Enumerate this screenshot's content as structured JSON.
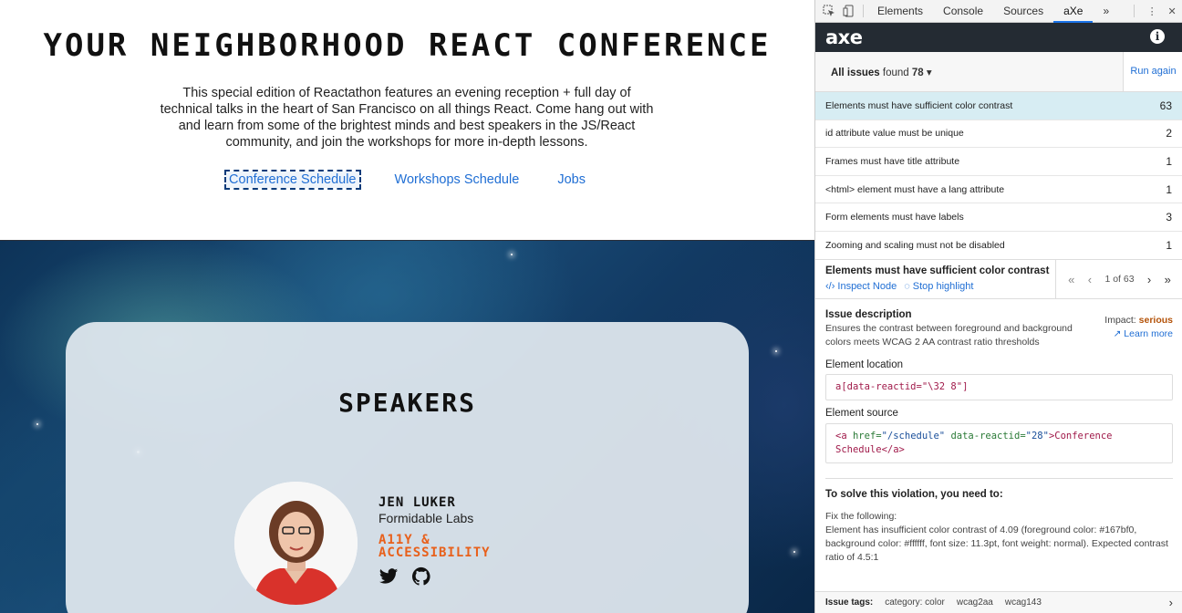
{
  "site": {
    "title": "YOUR NEIGHBORHOOD REACT CONFERENCE",
    "description": "This special edition of Reactathon features an evening reception + full day of technical talks in the heart of San Francisco on all things React. Come hang out with and learn from some of the brightest minds and best speakers in the JS/React community, and join the workshops for more in-depth lessons.",
    "nav": [
      "Conference Schedule",
      "Workshops Schedule",
      "Jobs"
    ],
    "speakers_heading": "SPEAKERS",
    "speaker": {
      "name": "JEN LUKER",
      "company": "Formidable Labs",
      "topic": "A11Y & ACCESSIBILITY"
    },
    "social_icons": [
      "twitter-icon",
      "github-icon"
    ]
  },
  "devtools": {
    "tabs": [
      "Elements",
      "Console",
      "Sources",
      "aXe"
    ],
    "active_tab": "aXe",
    "more": "»",
    "axe_logo": "axe",
    "issues_label": "All issues",
    "issues_found_label": "found",
    "issues_total": "78",
    "run_again": "Run again",
    "issues": [
      {
        "label": "Elements must have sufficient color contrast",
        "count": "63"
      },
      {
        "label": "id attribute value must be unique",
        "count": "2"
      },
      {
        "label": "Frames must have title attribute",
        "count": "1"
      },
      {
        "label": "<html> element must have a lang attribute",
        "count": "1"
      },
      {
        "label": "Form elements must have labels",
        "count": "3"
      },
      {
        "label": "Zooming and scaling must not be disabled",
        "count": "1"
      }
    ],
    "detail": {
      "title": "Elements must have sufficient color contrast",
      "inspect_node": "Inspect Node",
      "stop_highlight": "Stop highlight",
      "pager": "1 of 63",
      "issue_description_h": "Issue description",
      "issue_description": "Ensures the contrast between foreground and background colors meets WCAG 2 AA contrast ratio thresholds",
      "impact_label": "Impact:",
      "impact_value": "serious",
      "learn_more": "Learn more",
      "element_location_h": "Element location",
      "element_location": "a[data-reactid=\"\\32 8\"]",
      "element_source_h": "Element source",
      "source_tag_open": "<a",
      "source_attr1": "href=",
      "source_val1": "\"/schedule\"",
      "source_attr2": "data-reactid=",
      "source_val2": "\"28\"",
      "source_text": ">Conference",
      "source_text2": "Schedule</",
      "source_tag_close": "a",
      "source_end": ">",
      "solve_h": "To solve this violation, you need to:",
      "fix_following": "Fix the following:",
      "fix_detail": "Element has insufficient color contrast of 4.09 (foreground color: #167bf0, background color: #ffffff, font size: 11.3pt, font weight: normal). Expected contrast ratio of 4.5:1"
    },
    "tags_label": "Issue tags:",
    "tags": [
      "category: color",
      "wcag2aa",
      "wcag143"
    ]
  }
}
